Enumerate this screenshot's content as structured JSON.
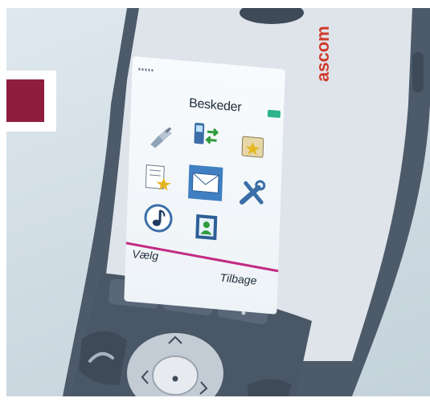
{
  "phone": {
    "brand": "ascom",
    "screen_title": "Beskeder",
    "softkey_left": "Vælg",
    "softkey_right": "Tilbage"
  },
  "menu_icons": [
    "network-plug-icon",
    "phone-transfer-icon",
    "folder-star-icon",
    "list-star-icon",
    "envelope-icon",
    "tools-icon",
    "music-note-icon",
    "contacts-book-icon"
  ],
  "colors": {
    "brand_block": "#8e1d3e",
    "brand_text": "#d03b2e",
    "softkey_divider": "#c22a83",
    "battery": "#2bb38a"
  }
}
